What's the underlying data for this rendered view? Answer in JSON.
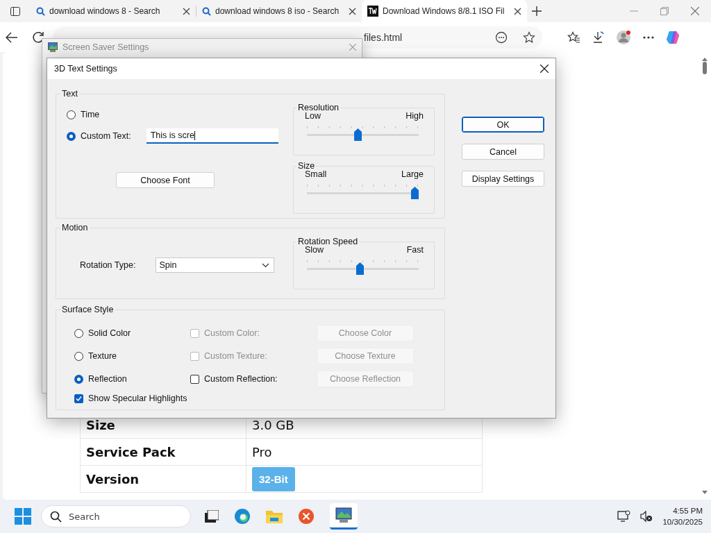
{
  "browser": {
    "tabs": [
      {
        "title": "download windows 8 - Search",
        "kind": "search",
        "selected": false
      },
      {
        "title": "download windows 8 iso - Search",
        "kind": "search",
        "selected": false
      },
      {
        "title": "Download Windows 8/8.1 ISO Fil",
        "kind": "site",
        "selected": true
      }
    ],
    "address": "files.html"
  },
  "page": {
    "rows": [
      {
        "label": "Size",
        "value": "3.0 GB",
        "kind": "text"
      },
      {
        "label": "Service Pack",
        "value": "Pro",
        "kind": "text"
      },
      {
        "label": "Version",
        "value": "32-Bit",
        "kind": "badge"
      }
    ]
  },
  "background_dialog": {
    "title": "Screen Saver Settings"
  },
  "dialog": {
    "title": "3D Text Settings",
    "text_group": {
      "label": "Text",
      "options": [
        {
          "label": "Time",
          "selected": false
        },
        {
          "label": "Custom Text:",
          "selected": true
        }
      ],
      "custom_text": "This is scre",
      "choose_font": "Choose Font",
      "resolution": {
        "label": "Resolution",
        "min_label": "Low",
        "max_label": "High",
        "level": 0.45
      },
      "size": {
        "label": "Size",
        "min_label": "Small",
        "max_label": "Large",
        "level": 1
      }
    },
    "motion": {
      "label": "Motion",
      "rotation_type_label": "Rotation Type:",
      "rotation_type": "Spin",
      "rotation_speed": {
        "label": "Rotation Speed",
        "min_label": "Slow",
        "max_label": "Fast",
        "level": 0.47
      }
    },
    "surface": {
      "label": "Surface Style",
      "rows": [
        {
          "option": "Solid Color",
          "selected": false,
          "checkbox": "Custom Color:",
          "checked": false,
          "checkbox_disabled": true,
          "button": "Choose Color",
          "button_disabled": true
        },
        {
          "option": "Texture",
          "selected": false,
          "checkbox": "Custom Texture:",
          "checked": false,
          "checkbox_disabled": true,
          "button": "Choose Texture",
          "button_disabled": true
        },
        {
          "option": "Reflection",
          "selected": true,
          "checkbox": "Custom Reflection:",
          "checked": false,
          "checkbox_disabled": false,
          "button": "Choose Reflection",
          "button_disabled": true
        }
      ],
      "specular": {
        "label": "Show Specular Highlights",
        "checked": true
      }
    },
    "buttons": [
      {
        "label": "OK",
        "default": true
      },
      {
        "label": "Cancel",
        "default": false
      },
      {
        "label": "Display Settings",
        "default": false
      }
    ]
  },
  "taskbar": {
    "search_placeholder": "Search",
    "time": "4:55 PM",
    "date": "10/30/2025"
  }
}
